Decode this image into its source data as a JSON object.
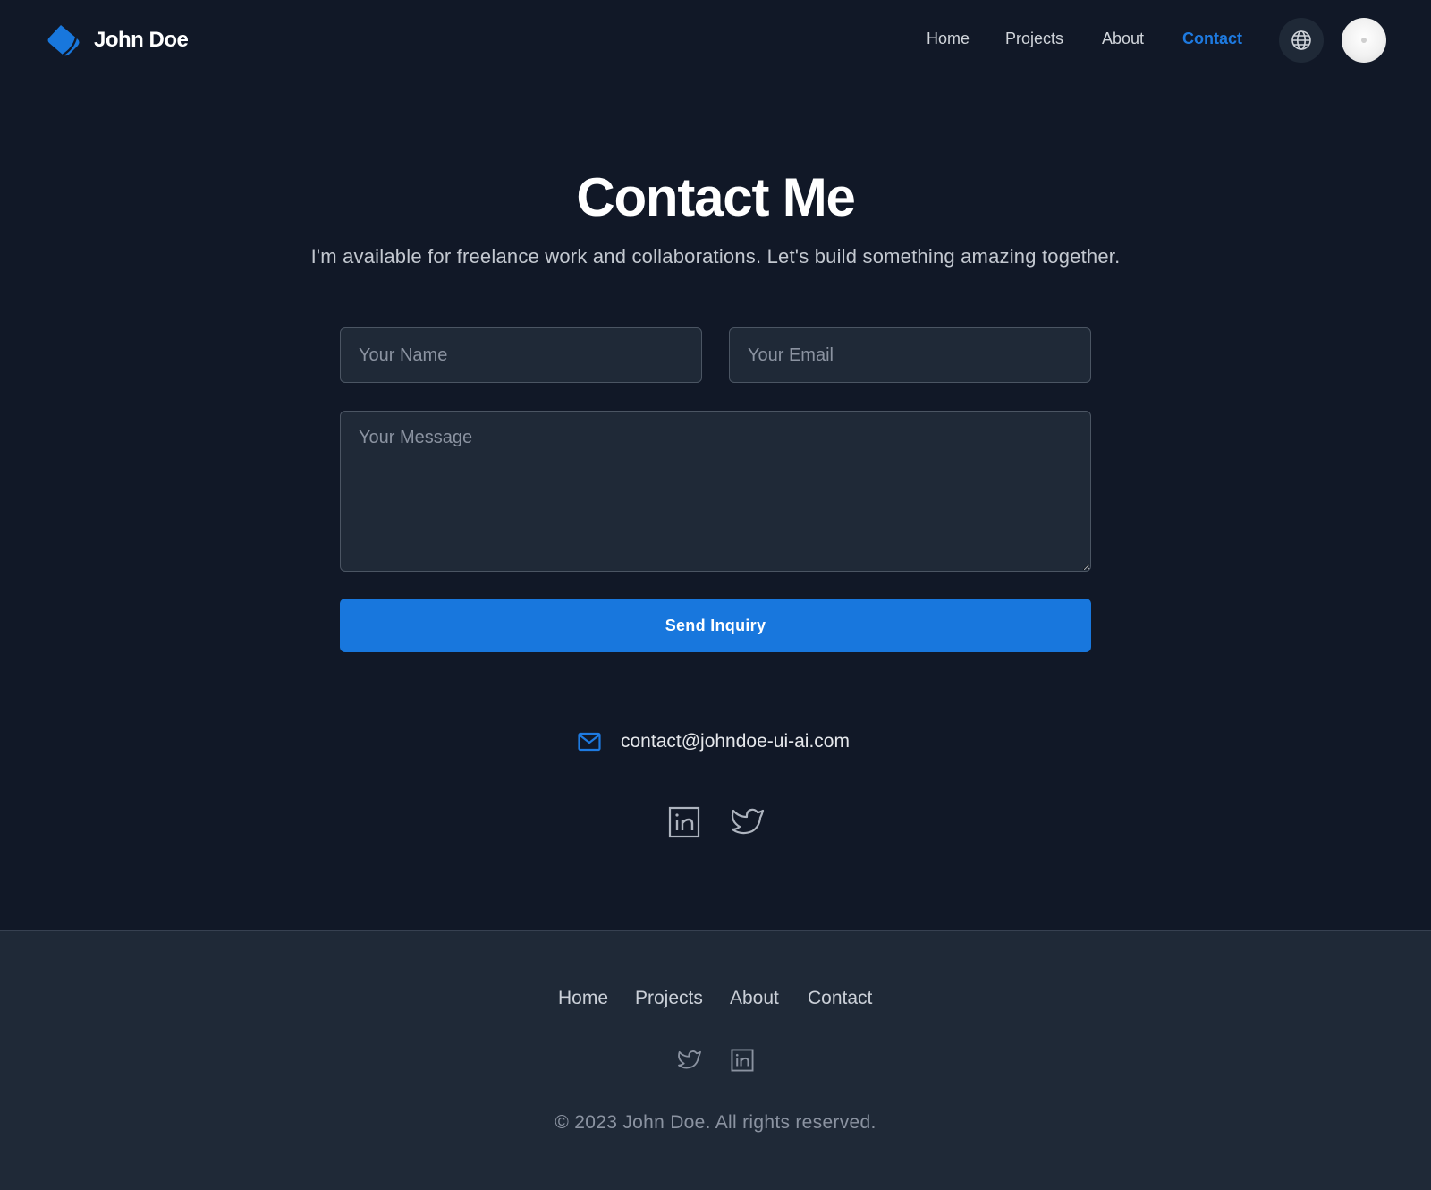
{
  "header": {
    "brand_name": "John Doe",
    "nav": {
      "home": "Home",
      "projects": "Projects",
      "about": "About",
      "contact": "Contact"
    },
    "active_nav": "Contact",
    "icons": {
      "logo": "droplet-logo-icon",
      "language": "globe-icon",
      "avatar": "user-avatar"
    }
  },
  "main": {
    "title": "Contact Me",
    "subtitle": "I'm available for freelance work and collaborations. Let's build something amazing together.",
    "form": {
      "name_placeholder": "Your Name",
      "email_placeholder": "Your Email",
      "message_placeholder": "Your Message",
      "submit_label": "Send Inquiry"
    },
    "email": "contact@johndoe-ui-ai.com",
    "icons": {
      "email": "mail-icon",
      "social": [
        "linkedin-icon",
        "twitter-icon"
      ]
    }
  },
  "footer": {
    "nav": {
      "home": "Home",
      "projects": "Projects",
      "about": "About",
      "contact": "Contact"
    },
    "social_icons": [
      "twitter-icon",
      "linkedin-icon"
    ],
    "copyright": "© 2023 John Doe. All rights reserved."
  },
  "colors": {
    "background": "#111827",
    "surface": "#1f2937",
    "accent": "#1877dd",
    "text": "#ffffff",
    "muted_text": "#8b93a1"
  }
}
